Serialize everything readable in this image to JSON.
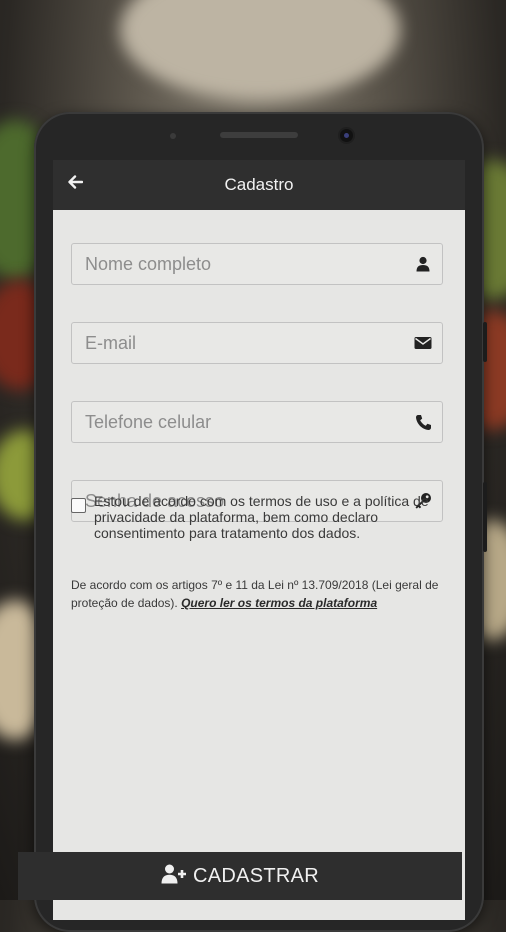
{
  "appbar": {
    "title": "Cadastro"
  },
  "form": {
    "name_placeholder": "Nome completo",
    "email_placeholder": "E-mail",
    "phone_placeholder": "Telefone celular",
    "password_placeholder": "Senha de acesso"
  },
  "consent": {
    "text": "Estou de acordo com os termos de uso e a política de privacidade da plataforma, bem como declaro consentimento para tratamento dos dados."
  },
  "legal": {
    "text": "De acordo com os artigos 7º e 11 da Lei nº 13.709/2018 (Lei geral de proteção de dados). ",
    "link": "Quero ler os termos da plataforma"
  },
  "footer": {
    "button_label": "CADASTRAR"
  },
  "icons": {
    "back": "arrow-left-icon",
    "name": "user-icon",
    "email": "envelope-icon",
    "phone": "phone-icon",
    "password": "key-icon",
    "submit": "user-plus-icon"
  },
  "colors": {
    "appbar": "#2f2f2f",
    "screen": "#e6e6e4",
    "footer": "#2e2e2e"
  }
}
